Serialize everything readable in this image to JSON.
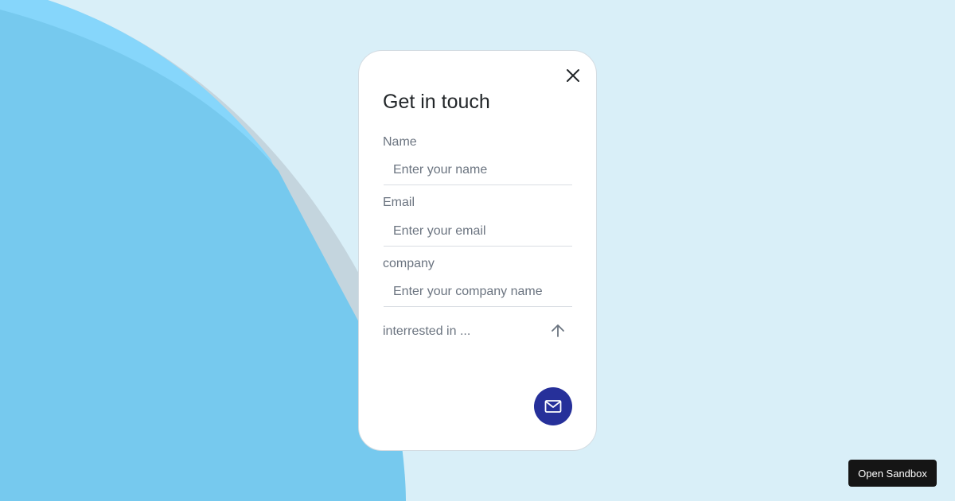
{
  "form": {
    "title": "Get in touch",
    "fields": [
      {
        "label": "Name",
        "placeholder": "Enter your name"
      },
      {
        "label": "Email",
        "placeholder": "Enter your email"
      },
      {
        "label": "company",
        "placeholder": "Enter your company name"
      }
    ],
    "interest_label": "interrested in ...",
    "icons": {
      "close": "close-icon",
      "expand": "arrow-up-icon",
      "send": "mail-icon"
    },
    "colors": {
      "send_button": "#26309a",
      "background": "#d9eff8",
      "blob_primary": "#76c9ee",
      "blob_highlight": "#86d6fb"
    }
  },
  "footer": {
    "sandbox_label": "Open Sandbox"
  }
}
